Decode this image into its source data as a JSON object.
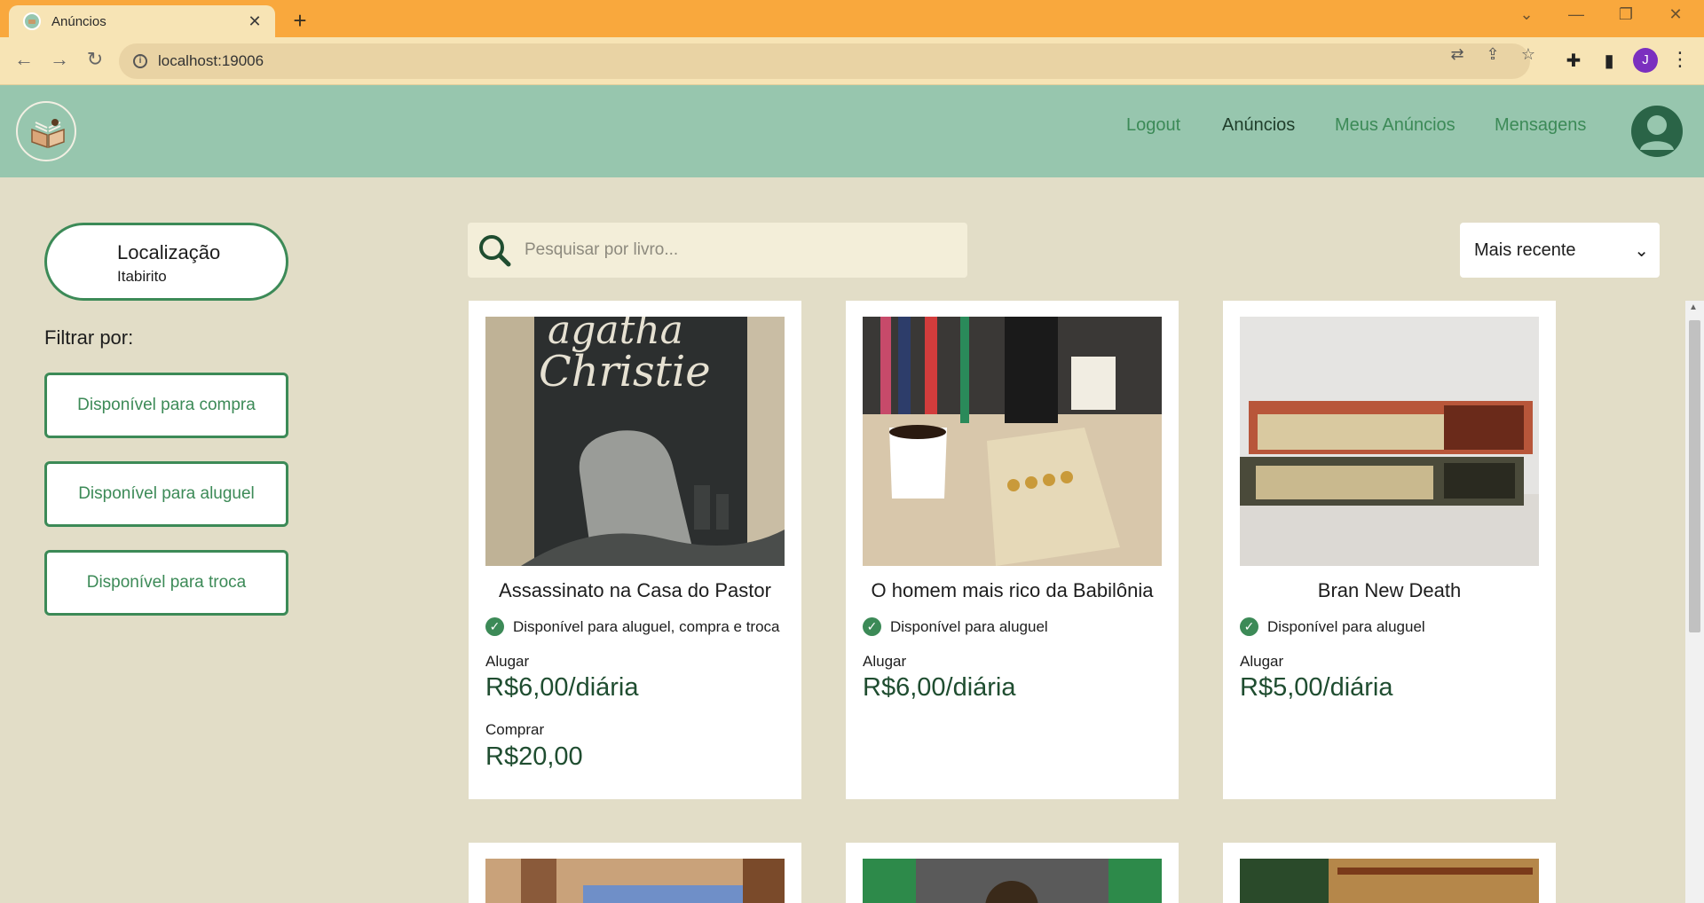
{
  "browser": {
    "tab_title": "Anúncios",
    "tab_close": "✕",
    "new_tab": "+",
    "url": "localhost:19006",
    "profile_initial": "J",
    "window_controls": {
      "list": "⌄",
      "minimize": "—",
      "restore": "❐",
      "close": "✕"
    }
  },
  "header": {
    "nav": [
      {
        "label": "Logout",
        "active": false
      },
      {
        "label": "Anúncios",
        "active": true
      },
      {
        "label": "Meus Anúncios",
        "active": false
      },
      {
        "label": "Mensagens",
        "active": false
      }
    ]
  },
  "sidebar": {
    "location_title": "Localização",
    "location_city": "Itabirito",
    "filter_label": "Filtrar por:",
    "filters": [
      "Disponível para compra",
      "Disponível para aluguel",
      "Disponível para troca"
    ]
  },
  "search": {
    "placeholder": "Pesquisar por livro..."
  },
  "sort": {
    "selected": "Mais recente"
  },
  "listings": [
    {
      "title": "Assassinato na Casa do Pastor",
      "availability": "Disponível para aluguel, compra e troca",
      "rent_label": "Alugar",
      "rent_price": "R$6,00/diária",
      "buy_label": "Comprar",
      "buy_price": "R$20,00"
    },
    {
      "title": "O homem mais rico da Babilônia",
      "availability": "Disponível para aluguel",
      "rent_label": "Alugar",
      "rent_price": "R$6,00/diária"
    },
    {
      "title": "Bran New Death",
      "availability": "Disponível para aluguel",
      "rent_label": "Alugar",
      "rent_price": "R$5,00/diária"
    }
  ],
  "colors": {
    "accent": "#3c8a57",
    "header_bg": "#97c6ae",
    "page_bg": "#e2ddc7",
    "tabbar": "#f9a83d"
  },
  "icons": {
    "search": "search-icon",
    "check": "check-circle-icon",
    "user": "user-circle-icon",
    "logo": "open-book-icon"
  }
}
